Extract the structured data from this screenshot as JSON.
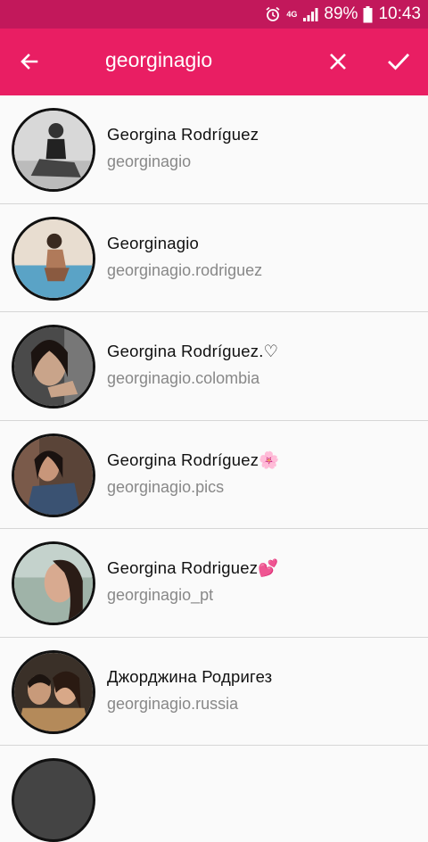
{
  "status_bar": {
    "network": "4G",
    "battery": "89%",
    "time": "10:43"
  },
  "toolbar": {
    "query": "georginagio",
    "back_icon": "arrow-left-icon",
    "clear_icon": "close-icon",
    "confirm_icon": "check-icon"
  },
  "results": [
    {
      "name": "Georgina Rodríguez",
      "handle": "georginagio"
    },
    {
      "name": "Georginagio",
      "handle": "georginagio.rodriguez"
    },
    {
      "name": "Georgina Rodríguez.♡",
      "handle": "georginagio.colombia"
    },
    {
      "name": "Georgina Rodríguez🌸",
      "handle": "georginagio.pics"
    },
    {
      "name": "Georgina Rodriguez💕",
      "handle": "georginagio_pt"
    },
    {
      "name": "Джорджина Родригез",
      "handle": "georginagio.russia"
    }
  ],
  "colors": {
    "status_bar": "#c2185b",
    "app_bar": "#e91e63"
  }
}
